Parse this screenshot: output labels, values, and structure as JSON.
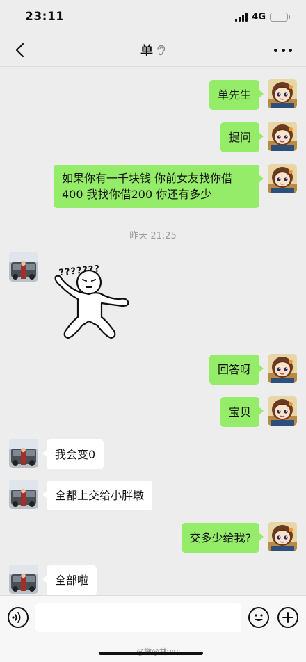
{
  "status_bar": {
    "time": "23:11",
    "network": "4G",
    "battery_level": 0.65,
    "battery_color": "#f6c33b"
  },
  "header": {
    "title": "单",
    "icons": [
      "back-arrow-icon",
      "ear-icon",
      "more-icon"
    ]
  },
  "colors": {
    "my_bubble": "#95ec69",
    "their_bubble": "#ffffff",
    "background": "#ededed"
  },
  "messages": [
    {
      "sender": "me",
      "text": "单先生"
    },
    {
      "sender": "me",
      "text": "提问"
    },
    {
      "sender": "me",
      "line1": "如果你有一千块钱  你前女友找你借",
      "line2": "400 我找你借200  你还有多少"
    },
    {
      "timestamp": "昨天 21:25"
    },
    {
      "sender": "them",
      "sticker_text": "???????"
    },
    {
      "sender": "me",
      "text": "回答呀"
    },
    {
      "sender": "me",
      "text": "宝贝"
    },
    {
      "sender": "them",
      "text": "我会变0"
    },
    {
      "sender": "them",
      "text": "全都上交给小胖墩"
    },
    {
      "sender": "me",
      "text": "交多少给我?"
    },
    {
      "sender": "them",
      "text": "全部啦"
    }
  ],
  "input_bar": {
    "icons": [
      "voice-icon",
      "emoji-icon",
      "plus-icon"
    ]
  },
  "watermark": "@微@林vivi"
}
